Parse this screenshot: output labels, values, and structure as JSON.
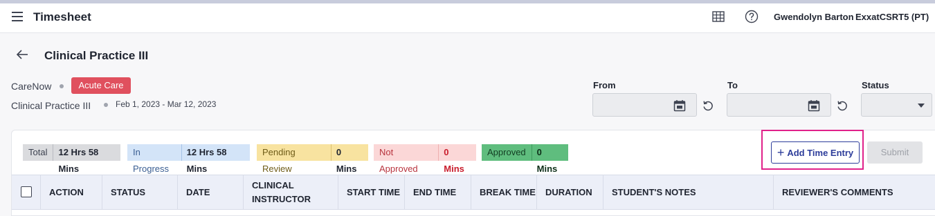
{
  "header": {
    "title": "Timesheet",
    "user_name": "Gwendolyn Barton",
    "org": "ExxatCSRT5 (PT)"
  },
  "page": {
    "title": "Clinical Practice III",
    "site": "CareNow",
    "tag": "Acute Care",
    "course": "Clinical Practice III",
    "date_range": "Feb 1, 2023 - Mar 12, 2023"
  },
  "filters": {
    "from_label": "From",
    "to_label": "To",
    "status_label": "Status",
    "from_value": "",
    "to_value": "",
    "status_value": ""
  },
  "summary": {
    "total_label": "Total",
    "total_value": "12 Hrs 58 Mins",
    "in_progress_label": "In Progress",
    "in_progress_value": "12 Hrs 58 Mins",
    "pending_label": "Pending Review",
    "pending_value": "0 Mins",
    "not_approved_label": "Not Approved",
    "not_approved_value": "0 Mins",
    "approved_label": "Approved",
    "approved_value": "0 Mins"
  },
  "actions": {
    "add_label": "Add Time Entry",
    "submit_label": "Submit"
  },
  "table": {
    "columns": [
      "ACTION",
      "STATUS",
      "DATE",
      "CLINICAL INSTRUCTOR",
      "START TIME",
      "END TIME",
      "BREAK TIME",
      "DURATION",
      "STUDENT'S NOTES",
      "REVIEWER'S COMMENTS"
    ]
  },
  "colors": {
    "tag_bg": "#e0505e",
    "highlight": "#e0218a",
    "primary": "#2c3c9a"
  }
}
